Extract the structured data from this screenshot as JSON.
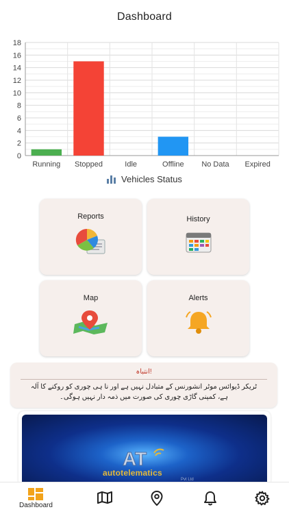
{
  "header": {
    "title": "Dashboard"
  },
  "chart_data": {
    "type": "bar",
    "categories": [
      "Running",
      "Stopped",
      "Idle",
      "Offline",
      "No Data",
      "Expired"
    ],
    "values": [
      1,
      15,
      0,
      3,
      0,
      0
    ],
    "colors": [
      "#4caf50",
      "#f44336",
      "#9e9e9e",
      "#2196f3",
      "#9e9e9e",
      "#9e9e9e"
    ],
    "ylim": [
      0,
      18
    ],
    "yticks": [
      0,
      2,
      4,
      6,
      8,
      10,
      12,
      14,
      16,
      18
    ],
    "grid": true,
    "legend": "Vehicles Status"
  },
  "menu": {
    "reports": "Reports",
    "history": "History",
    "map": "Map",
    "alerts": "Alerts"
  },
  "warning": {
    "title": "انتباہ!",
    "body": "ٹریکر ڈیوائس موٹر انشورنس کے متبادل نہیں ہے اور نا ہی چوری کو روکنے کا آلہ ہے، کمپنی گاڑی چوری کی صورت میں ذمہ دار نہیں ہوگی۔"
  },
  "banner": {
    "logo_mark": "AT",
    "brand": "autotelematics",
    "sub": "Pvt Ltd"
  },
  "nav": {
    "dashboard": "Dashboard",
    "icons": [
      "dashboard-icon",
      "map-icon",
      "location-pin-icon",
      "bell-icon",
      "gear-icon"
    ]
  }
}
